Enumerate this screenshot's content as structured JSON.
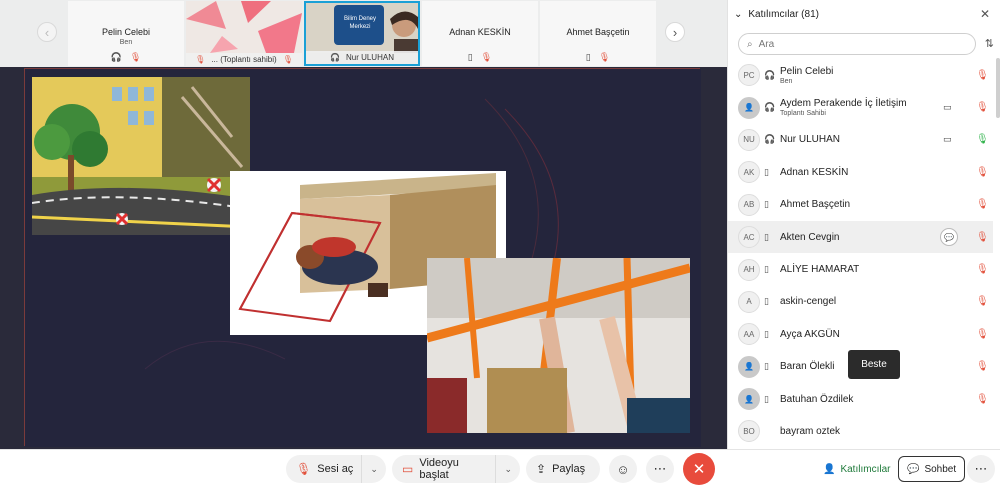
{
  "strip": {
    "prev_icon": "chevron-left-icon",
    "next_icon": "chevron-right-icon",
    "tiles": [
      {
        "name": "Pelin Celebi",
        "sub": "Ben"
      },
      {
        "name": "... (Toplantı sahibi)"
      },
      {
        "name": "Nur ULUHAN"
      },
      {
        "name": "Adnan KESKİN"
      },
      {
        "name": "Ahmet Başçetin"
      }
    ],
    "banner_text": "Bilim Deney Merkezi"
  },
  "panel": {
    "title": "Katılımcılar (81)",
    "search_placeholder": "Ara",
    "participants": [
      {
        "initials": "PC",
        "name": "Pelin Celebi",
        "role": "Ben",
        "device": "headset-icon",
        "mic": "muted"
      },
      {
        "initials": "",
        "name": "Aydem Perakende İç İletişim",
        "role": "Toplantı Sahibi",
        "device": "headset-icon",
        "camera": true,
        "mic": "muted"
      },
      {
        "initials": "NU",
        "name": "Nur ULUHAN",
        "device": "headset-icon",
        "camera": true,
        "mic": "active"
      },
      {
        "initials": "AK",
        "name": "Adnan KESKİN",
        "device": "phone-icon",
        "mic": "muted"
      },
      {
        "initials": "AB",
        "name": "Ahmet Başçetin",
        "device": "phone-icon",
        "mic": "muted"
      },
      {
        "initials": "AC",
        "name": "Akten Cevgin",
        "device": "phone-icon",
        "chat": true,
        "mic": "muted"
      },
      {
        "initials": "AH",
        "name": "ALİYE HAMARAT",
        "device": "phone-icon",
        "mic": "muted"
      },
      {
        "initials": "A",
        "name": "askin-cengel",
        "device": "phone-icon",
        "mic": "muted"
      },
      {
        "initials": "AA",
        "name": "Ayça AKGÜN",
        "device": "phone-icon",
        "mic": "muted"
      },
      {
        "initials": "",
        "name": "Baran Ölekli",
        "device": "phone-icon",
        "mic": "muted"
      },
      {
        "initials": "",
        "name": "Batuhan Özdilek",
        "device": "phone-icon",
        "mic": "muted"
      },
      {
        "initials": "BO",
        "name": "bayram oztek",
        "device": "",
        "mic": ""
      }
    ],
    "tooltip": "Beste"
  },
  "toolbar": {
    "audio_label": "Sesi aç",
    "video_label": "Videoyu başlat",
    "share_label": "Paylaş",
    "participants_label": "Katılımcılar",
    "chat_label": "Sohbet",
    "colors": {
      "end": "#e84b3c",
      "muted": "#e2513c",
      "active_mic": "#2fb24a",
      "accent": "#1aa0d6",
      "participants_btn": "#1f7a3a"
    }
  }
}
